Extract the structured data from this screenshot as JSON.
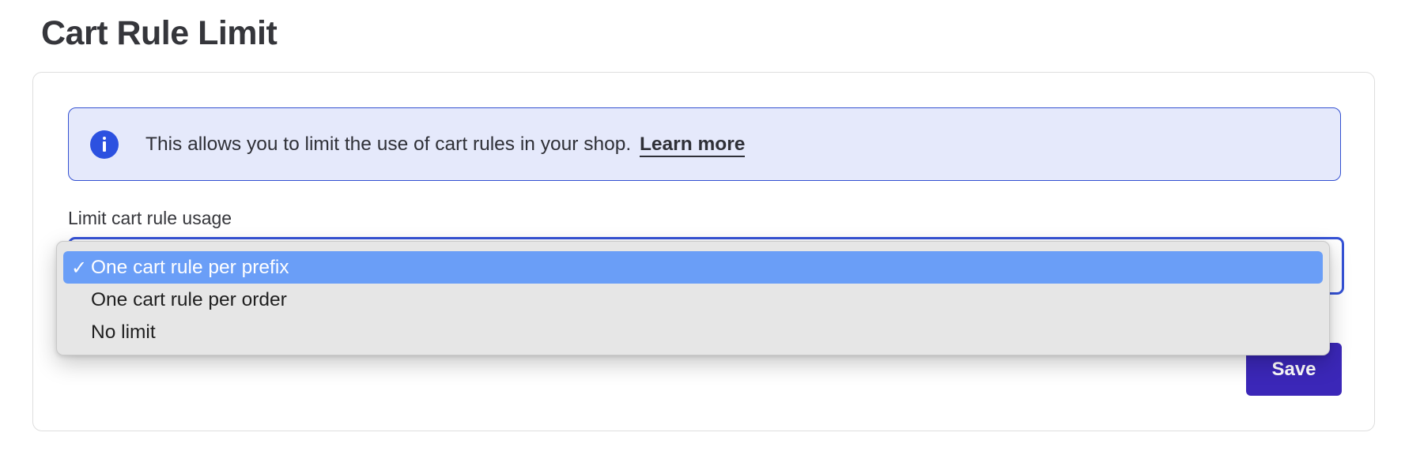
{
  "page": {
    "title": "Cart Rule Limit"
  },
  "alert": {
    "icon": "info-icon",
    "text": "This allows you to limit the use of cart rules in your shop.",
    "link_label": "Learn more",
    "color": "#2c51e0",
    "background": "#e5e9fb"
  },
  "form": {
    "field_label": "Limit cart rule usage",
    "selected_value": "One cart rule per prefix",
    "options": [
      {
        "label": "One cart rule per prefix",
        "selected": true
      },
      {
        "label": "One cart rule per order",
        "selected": false
      },
      {
        "label": "No limit",
        "selected": false
      }
    ],
    "check_glyph": "✓",
    "save_label": "Save",
    "save_color": "#3b27b8",
    "highlight_color": "#6a9ef7"
  }
}
